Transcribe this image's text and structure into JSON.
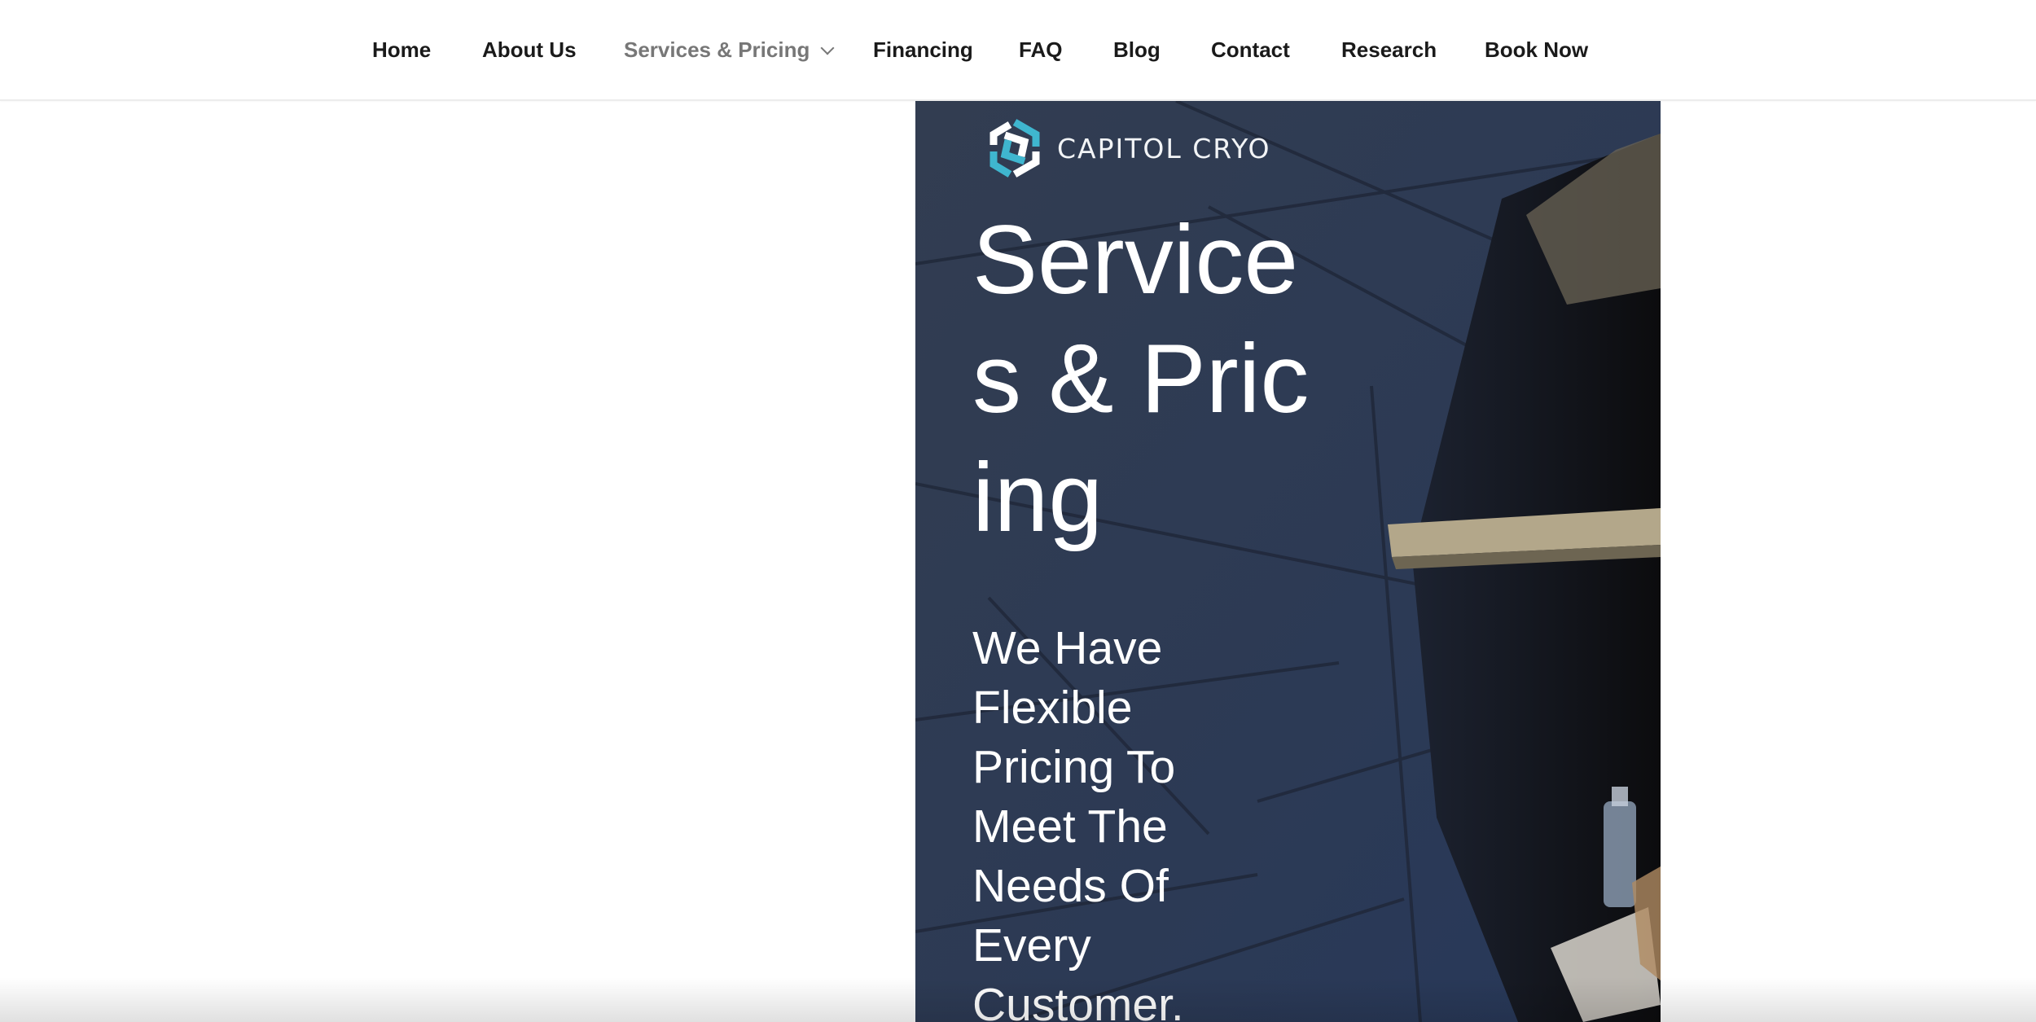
{
  "nav": {
    "items": [
      {
        "label": "Home"
      },
      {
        "label": "About Us"
      },
      {
        "label": "Services & Pricing",
        "active": true,
        "has_dropdown": true
      },
      {
        "label": "Financing"
      },
      {
        "label": "FAQ"
      },
      {
        "label": "Blog"
      },
      {
        "label": "Contact"
      },
      {
        "label": "Research"
      },
      {
        "label": "Book Now"
      }
    ]
  },
  "hero": {
    "logo_text": "CAPITOL CRYO",
    "logo_icon": "hexagonal-knot-logo-icon",
    "title": "Services & Pricing",
    "subtitle": "We Have Flexible Pricing To Meet The Needs Of Every Customer."
  },
  "colors": {
    "nav_text": "#1a1a1a",
    "nav_active": "#777777",
    "hero_bg": "#2e394c",
    "logo_accent": "#3fb6cf"
  }
}
